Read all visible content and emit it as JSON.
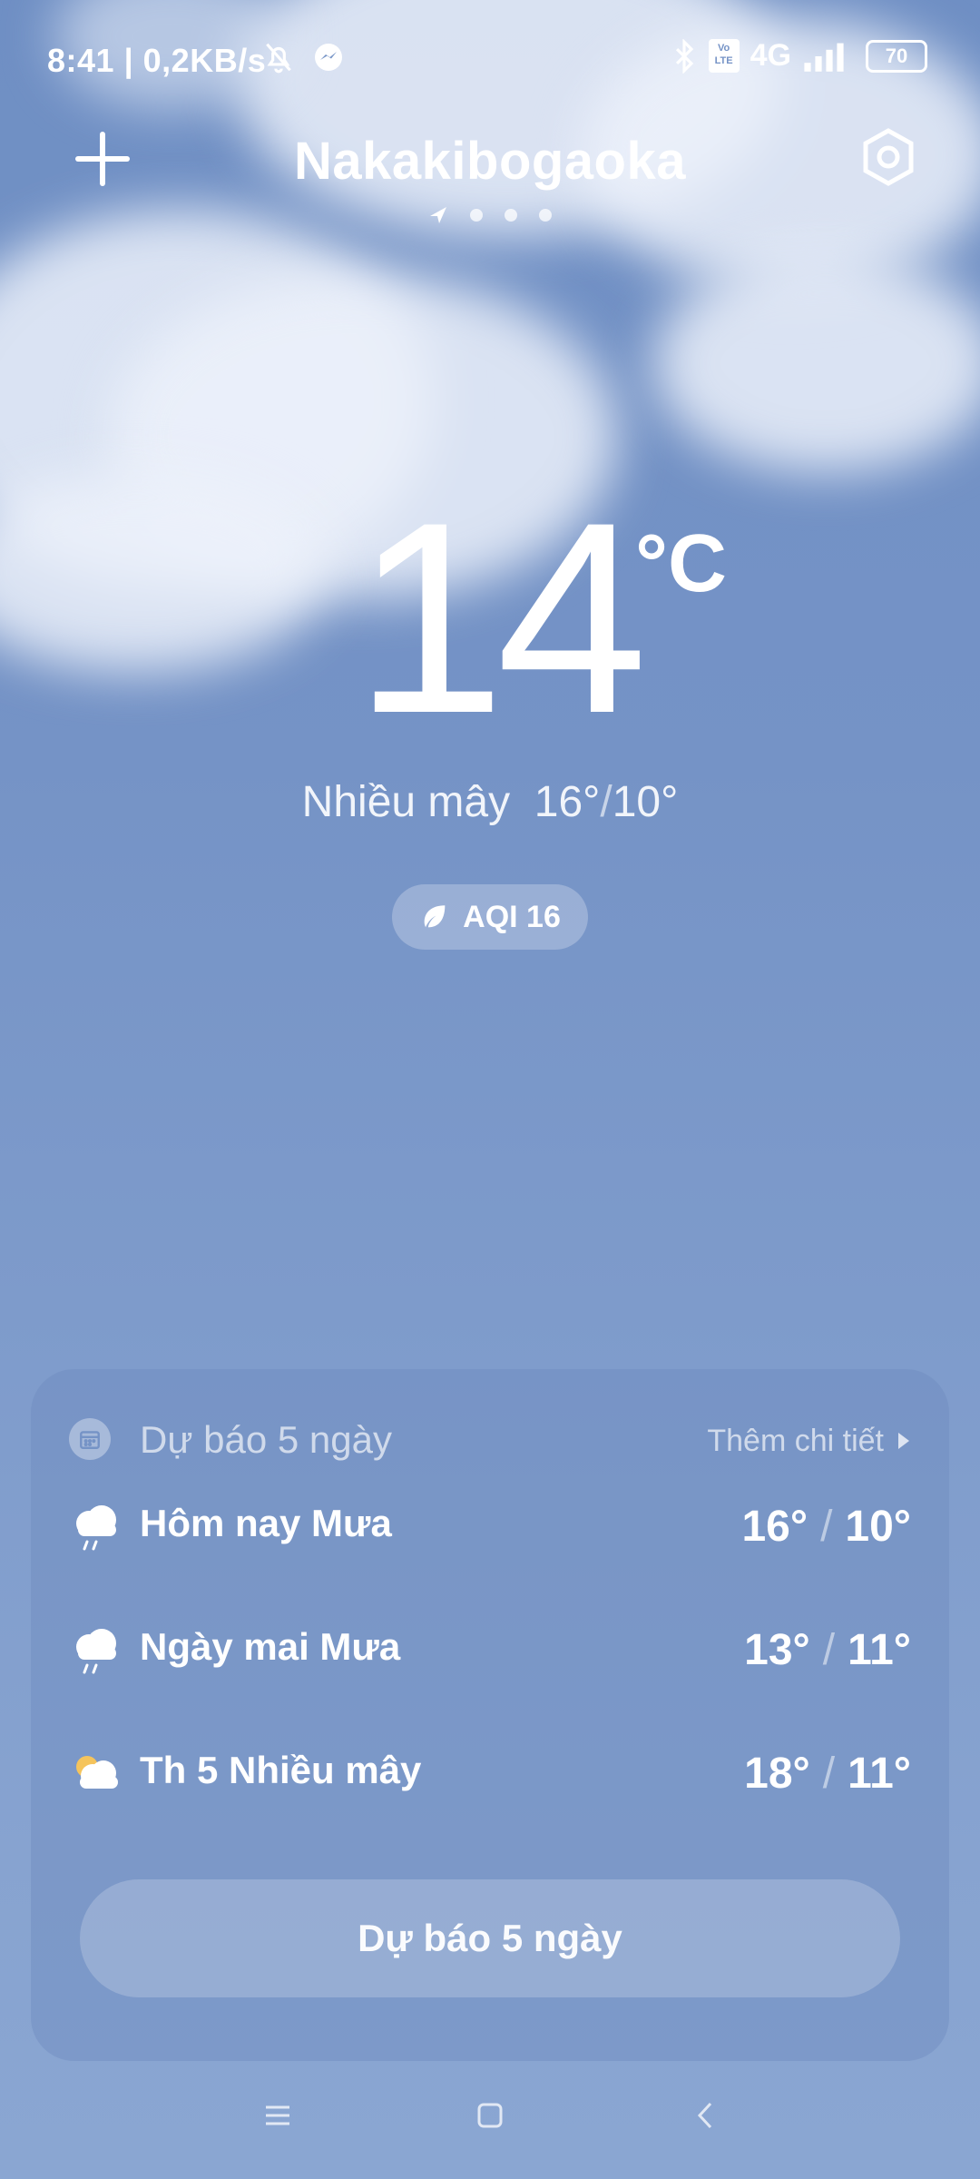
{
  "status_bar": {
    "time": "8:41",
    "net_speed": "| 0,2KB/s",
    "network": "4G",
    "volte": "Vo LTE",
    "battery": "70"
  },
  "header": {
    "city": "Nakakibogaoka",
    "page_count": 4,
    "active_page": 0
  },
  "current": {
    "temperature": "14",
    "unit": "°C",
    "condition": "Nhiều mây",
    "high": "16°",
    "low": "10°",
    "aqi_label": "AQI 16"
  },
  "forecast": {
    "title": "Dự báo 5 ngày",
    "more_label": "Thêm chi tiết",
    "days": [
      {
        "label": "Hôm nay  Mưa",
        "high": "16°",
        "low": "10°",
        "icon": "rain-icon"
      },
      {
        "label": "Ngày mai  Mưa",
        "high": "13°",
        "low": "11°",
        "icon": "rain-icon"
      },
      {
        "label": "Th 5  Nhiều mây",
        "high": "18°",
        "low": "11°",
        "icon": "partly-cloudy-icon"
      }
    ],
    "button_label": "Dự báo 5 ngày"
  },
  "colors": {
    "accent_sun": "#f5c45c"
  }
}
